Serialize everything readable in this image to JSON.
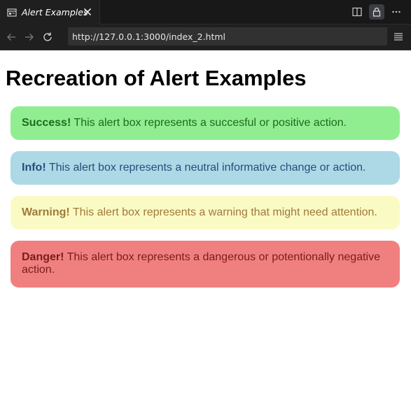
{
  "browser": {
    "tab_title": "Alert Examples",
    "url": "http://127.0.0.1:3000/index_2.html",
    "icons": {
      "tab": "page-icon",
      "close": "close-icon",
      "split": "split-view-icon",
      "lock": "lock-icon",
      "more": "more-icon",
      "back": "back-arrow-icon",
      "forward": "forward-arrow-icon",
      "reload": "reload-icon",
      "menu": "menu-icon"
    }
  },
  "page": {
    "title": "Recreation of Alert Examples",
    "alerts": [
      {
        "label": "Success!",
        "text": " This alert box represents a succesful or positive action.",
        "color": "#90ee90"
      },
      {
        "label": "Info!",
        "text": " This alert box represents a neutral informative change or action.",
        "color": "#add8e6"
      },
      {
        "label": "Warning!",
        "text": " This alert box represents a warning that might need attention.",
        "color": "#fafac4"
      },
      {
        "label": "Danger!",
        "text": " This alert box represents a dangerous or potentionally negative action.",
        "color": "#f08080"
      }
    ]
  }
}
